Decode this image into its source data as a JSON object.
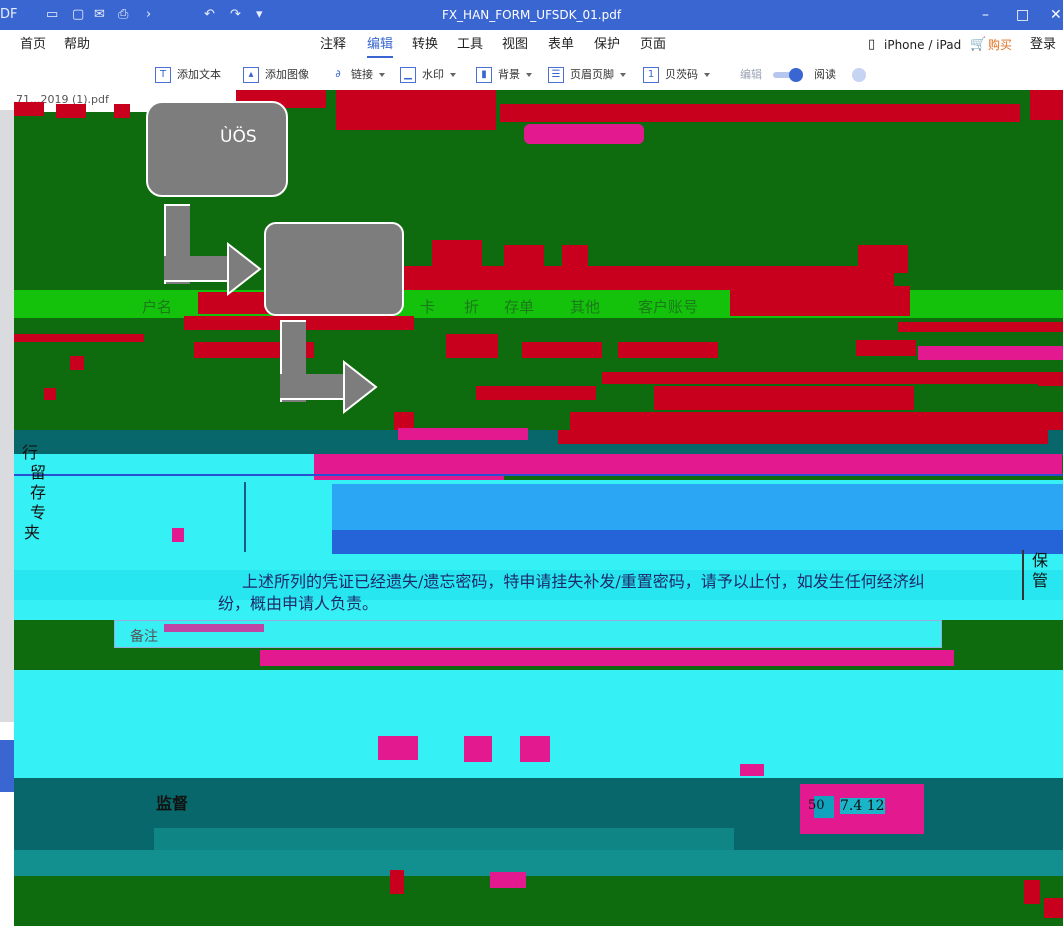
{
  "window": {
    "app_prefix": "DF",
    "title": "FX_HAN_FORM_UFSDK_01.pdf"
  },
  "menu": {
    "left": [
      "首页",
      "帮助"
    ],
    "center": [
      "注释",
      "编辑",
      "转换",
      "工具",
      "视图",
      "表单",
      "保护",
      "页面"
    ],
    "active": "编辑",
    "right": [
      "iPhone / iPad",
      "购买",
      "登录"
    ]
  },
  "toolbar": {
    "items": [
      "添加文本",
      "添加图像",
      "链接",
      "水印",
      "背景",
      "页眉页脚",
      "贝茨码"
    ],
    "edit_label": "编辑",
    "read_label": "阅读",
    "toggle_on": true
  },
  "tab": {
    "partial_label": "71...2019 (1).pdf"
  },
  "diagram": {
    "box1_label": "ÙÖS",
    "box2_label": ""
  },
  "document": {
    "header_cells": [
      "户名",
      "卡",
      "折",
      "存单",
      "其他",
      "客户账号"
    ],
    "vertical_chars": [
      "行",
      "留",
      "存",
      "专",
      "夹"
    ],
    "right_vertical": [
      "保",
      "管"
    ],
    "statement_line1": "上述所列的凭证已经遗失/遗忘密码，特申请挂失补发/重置密码，请予以止付，如发生任何经济纠",
    "statement_line2": "纷，概由申请人负责。",
    "remarks_label": "备注",
    "supervisor_label": "监督",
    "bottom_numbers": "7.4 12",
    "bottom_prefix": "50"
  },
  "colors": {
    "titlebar": "#3a66d1",
    "doc_background": "#0e6b0e",
    "glitch_red": "#c8001e",
    "glitch_magenta": "#e2198f",
    "glitch_cyan": "#35f1f6",
    "diagram_box": "#7d7d7d"
  }
}
